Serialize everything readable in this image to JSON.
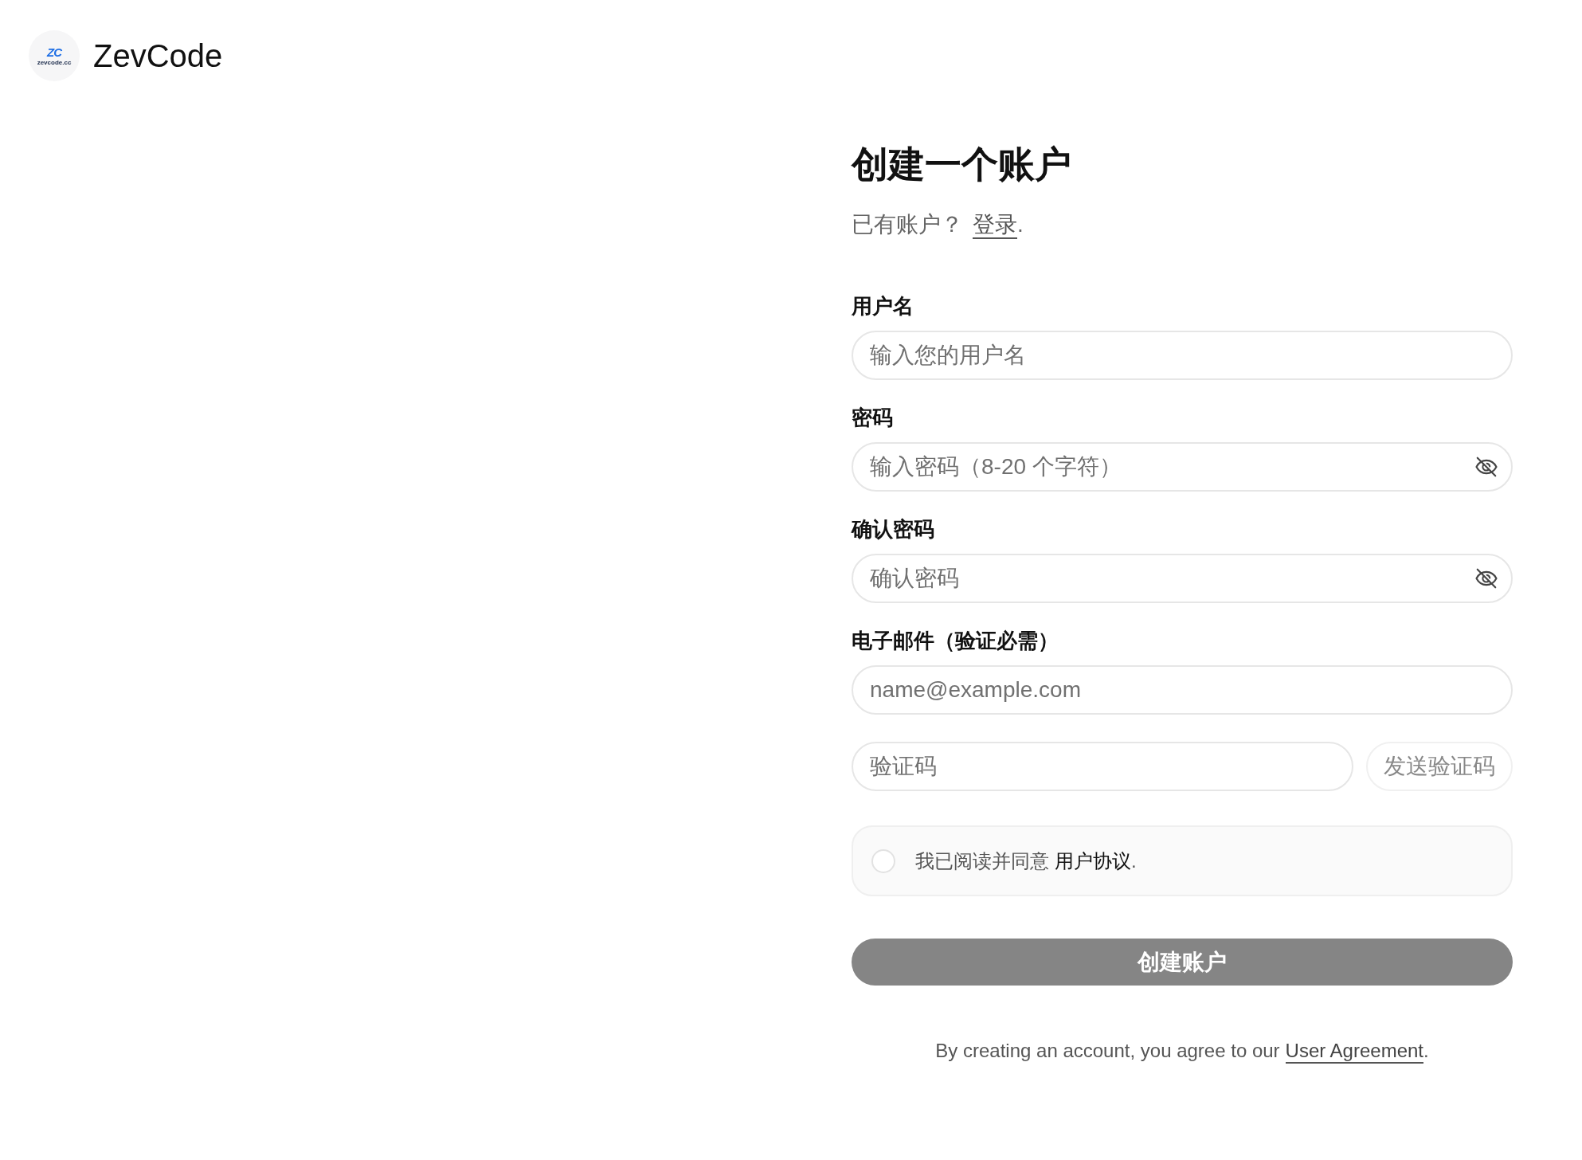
{
  "header": {
    "logo": {
      "monogram": "ZC",
      "domain": "zevcode.cc"
    },
    "brand": "ZevCode"
  },
  "form": {
    "title": "创建一个账户",
    "login_prompt": {
      "text": "已有账户？",
      "link": "登录",
      "suffix": "."
    },
    "fields": [
      {
        "kind": "text",
        "label": "用户名",
        "placeholder": "输入您的用户名"
      },
      {
        "kind": "password",
        "label": "密码",
        "placeholder": "输入密码（8-20 个字符）"
      },
      {
        "kind": "password",
        "label": "确认密码",
        "placeholder": "确认密码"
      },
      {
        "kind": "email",
        "label": "电子邮件（验证必需）",
        "placeholder": "name@example.com"
      }
    ],
    "verification": {
      "placeholder": "验证码",
      "send_button": {
        "label": "发送验证码",
        "disabled": true
      }
    },
    "agreement": {
      "checked": false,
      "text": "我已阅读并同意",
      "link": "用户协议",
      "suffix": "."
    },
    "create_button": {
      "label": "创建账户",
      "disabled": true
    },
    "footer": {
      "text": "By creating an account, you agree to our",
      "link": "User Agreement",
      "suffix": "."
    }
  }
}
